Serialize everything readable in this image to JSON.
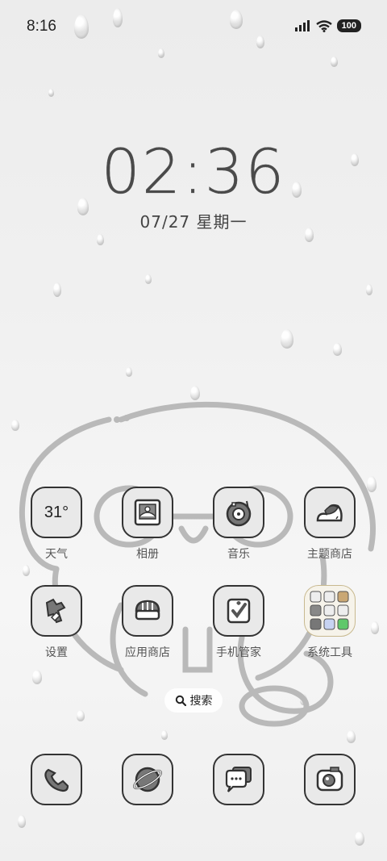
{
  "status_bar": {
    "time": "8:16",
    "battery": "100",
    "icons": [
      "signal-icon",
      "wifi-icon",
      "battery-icon"
    ]
  },
  "lock_clock": {
    "time": "02:36",
    "date": "07/27 星期一"
  },
  "apps_row1": [
    {
      "label": "天气",
      "icon": "weather-icon",
      "widget_text": "31°"
    },
    {
      "label": "相册",
      "icon": "gallery-icon"
    },
    {
      "label": "音乐",
      "icon": "music-icon"
    },
    {
      "label": "主题商店",
      "icon": "theme-store-icon"
    }
  ],
  "apps_row2": [
    {
      "label": "设置",
      "icon": "settings-icon"
    },
    {
      "label": "应用商店",
      "icon": "app-store-icon"
    },
    {
      "label": "手机管家",
      "icon": "phone-manager-icon"
    },
    {
      "label": "系统工具",
      "icon": "system-tools-folder-icon"
    }
  ],
  "search": {
    "label": "搜索",
    "icon": "search-icon"
  },
  "dock": [
    {
      "icon": "phone-icon"
    },
    {
      "icon": "browser-icon"
    },
    {
      "icon": "messages-icon"
    },
    {
      "icon": "camera-icon"
    }
  ],
  "colors": {
    "outline": "#333333",
    "icon_fill": "#e9e9e9",
    "background": "#efefef"
  }
}
